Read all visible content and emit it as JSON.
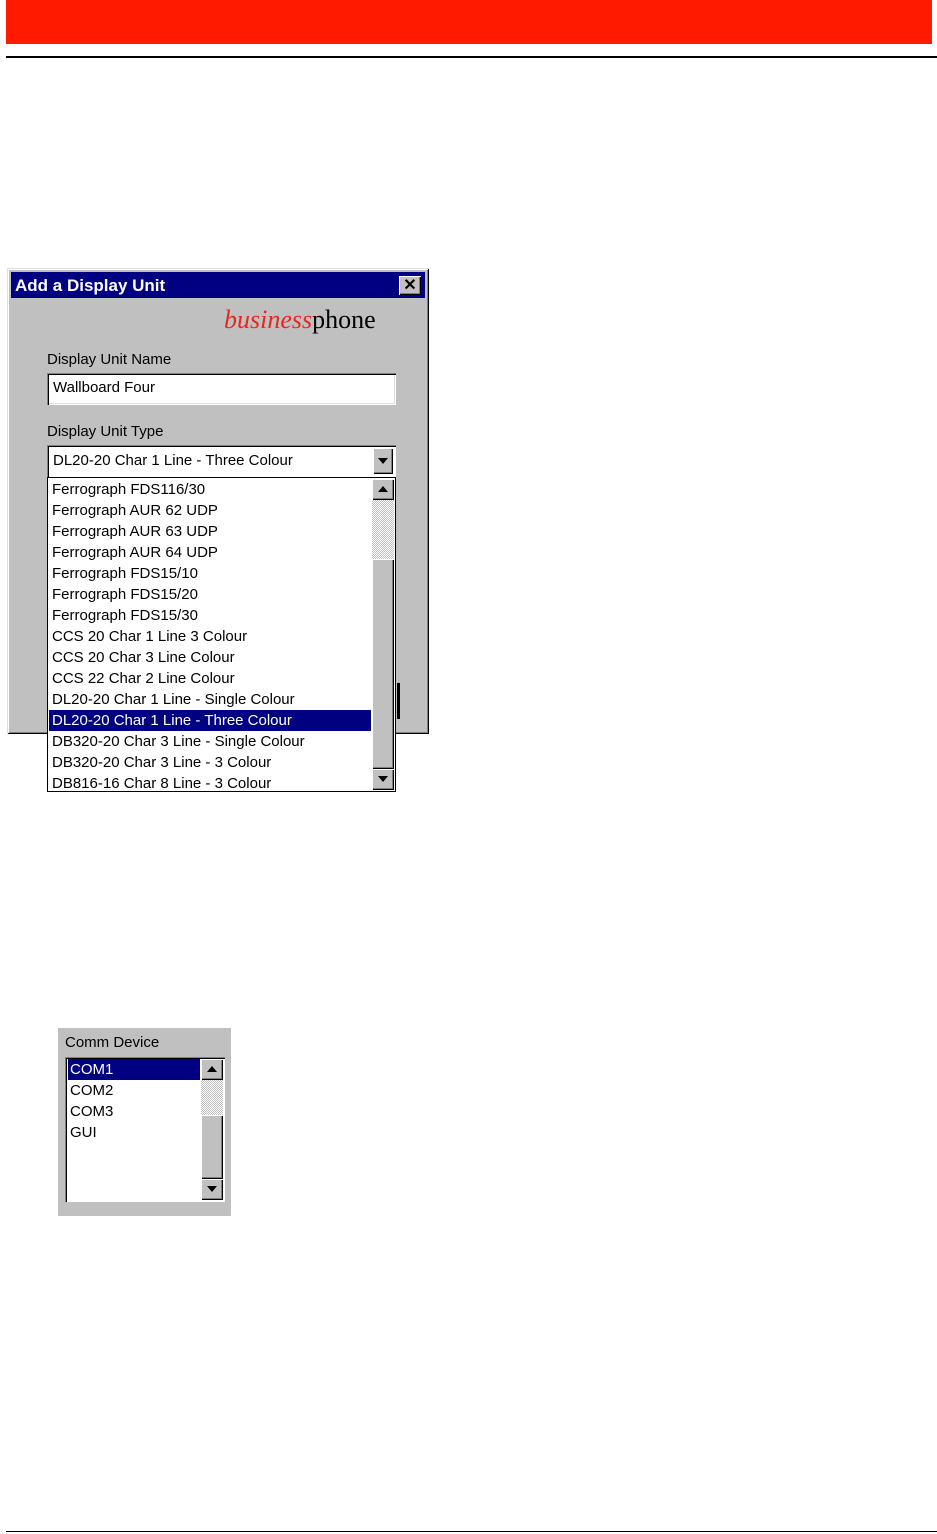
{
  "dialog": {
    "title": "Add a Display Unit",
    "close_glyph": "✕",
    "logo_part1": "business",
    "logo_part2": "phone",
    "name_label": "Display Unit Name",
    "name_value": "Wallboard Four",
    "type_label": "Display Unit Type",
    "type_value": "DL20-20 Char 1 Line - Three Colour",
    "type_options": [
      "Ferrograph FDS116/30",
      "Ferrograph AUR 62 UDP",
      "Ferrograph AUR 63 UDP",
      "Ferrograph AUR 64 UDP",
      "Ferrograph FDS15/10",
      "Ferrograph FDS15/20",
      "Ferrograph FDS15/30",
      "CCS 20 Char 1 Line 3 Colour",
      "CCS 20 Char 3 Line Colour",
      "CCS 22 Char 2 Line Colour",
      "DL20-20 Char 1 Line - Single Colour",
      "DL20-20 Char 1 Line - Three Colour",
      "DB320-20 Char 3 Line - Single Colour",
      "DB320-20 Char 3 Line - 3 Colour",
      "DB816-16 Char 8 Line - 3 Colour"
    ],
    "selected_index": 11
  },
  "comm": {
    "label": "Comm Device",
    "options": [
      "COM1",
      "COM2",
      "COM3",
      "GUI"
    ],
    "selected_index": 0
  },
  "colors": {
    "header_bar": "#ff1a00",
    "title_bar": "#000080",
    "dialog_bg": "#c0c0c0",
    "logo_accent": "#e8261c"
  }
}
